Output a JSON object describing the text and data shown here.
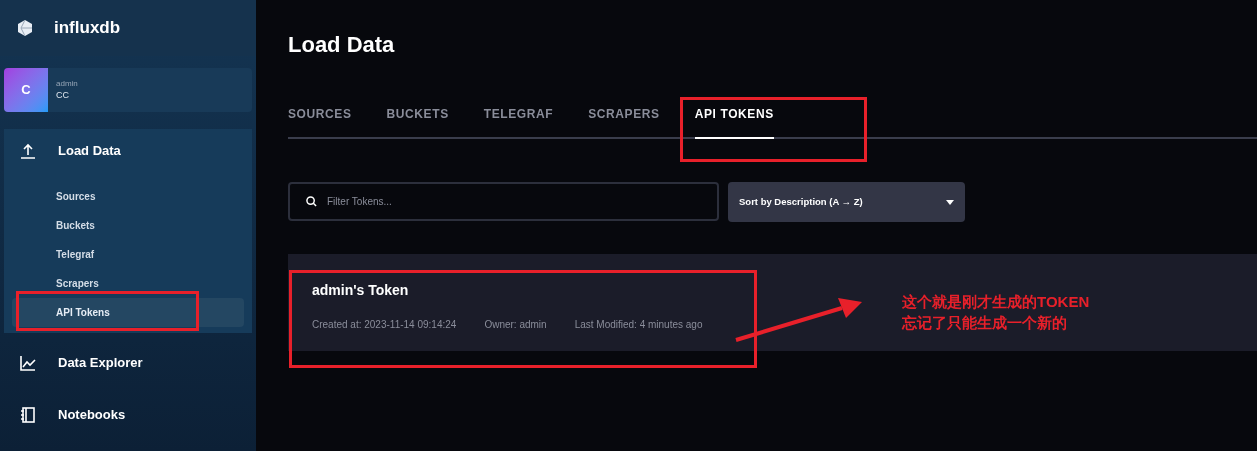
{
  "sidebar": {
    "logo": "influxdb",
    "org": {
      "initial": "C",
      "user": "admin",
      "name": "CC"
    },
    "nav": [
      {
        "label": "Load Data",
        "kind": "upload",
        "expanded": true,
        "children": [
          {
            "label": "Sources",
            "selected": false
          },
          {
            "label": "Buckets",
            "selected": false
          },
          {
            "label": "Telegraf",
            "selected": false
          },
          {
            "label": "Scrapers",
            "selected": false
          },
          {
            "label": "API Tokens",
            "selected": true
          }
        ]
      },
      {
        "label": "Data Explorer",
        "kind": "chart",
        "expanded": false
      },
      {
        "label": "Notebooks",
        "kind": "notebook",
        "expanded": false
      }
    ]
  },
  "page": {
    "title": "Load Data",
    "tabs": [
      {
        "label": "SOURCES",
        "selected": false
      },
      {
        "label": "BUCKETS",
        "selected": false
      },
      {
        "label": "TELEGRAF",
        "selected": false
      },
      {
        "label": "SCRAPERS",
        "selected": false
      },
      {
        "label": "API TOKENS",
        "selected": true
      }
    ],
    "filter": {
      "placeholder": "Filter Tokens..."
    },
    "sort": {
      "value": "Sort by Description (A → Z)"
    },
    "tokens": [
      {
        "name": "admin's Token",
        "created": "Created at: 2023-11-14 09:14:24",
        "owner": "Owner: admin",
        "modified": "Last Modified: 4 minutes ago"
      }
    ]
  },
  "annotation": {
    "lines": [
      "这个就是刚才生成的TOKEN",
      "忘记了只能生成一个新的"
    ]
  }
}
